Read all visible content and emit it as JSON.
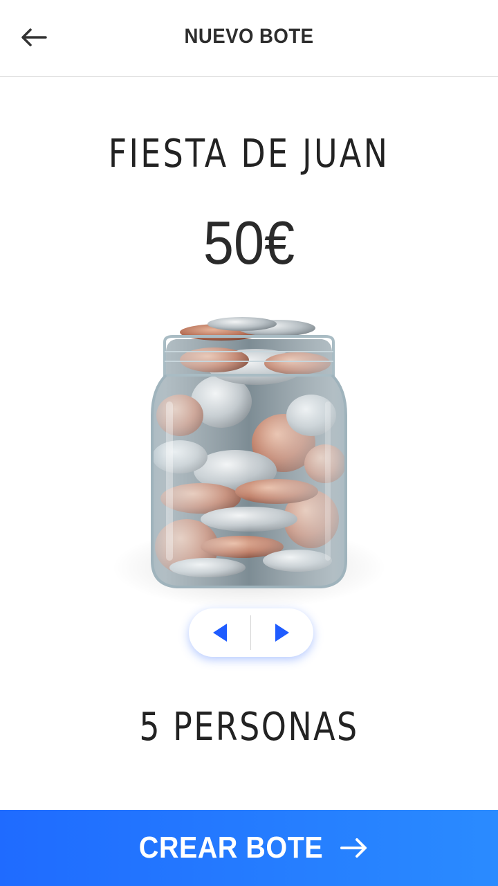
{
  "header": {
    "title": "NUEVO BOTE",
    "back_icon": "arrow-left-icon"
  },
  "pot": {
    "name": "FIESTA DE JUAN",
    "amount": "50€",
    "image": "coin-jar"
  },
  "pager": {
    "prev_icon": "triangle-left-icon",
    "next_icon": "triangle-right-icon",
    "accent": "#1f5cff"
  },
  "people": {
    "label": "5 PERSONAS"
  },
  "cta": {
    "label": "CREAR BOTE",
    "icon": "arrow-right-icon",
    "gradient_start": "#1f6bff",
    "gradient_end": "#2a8bff"
  }
}
